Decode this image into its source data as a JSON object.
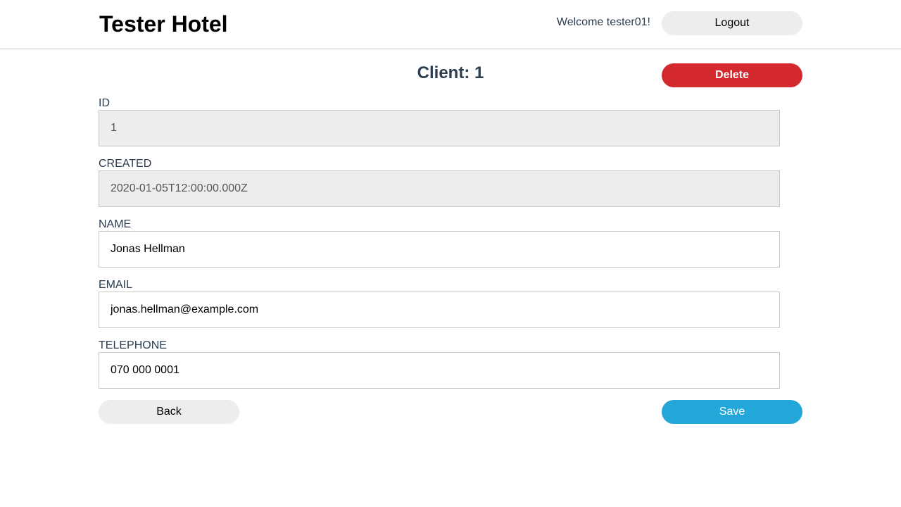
{
  "header": {
    "brand": "Tester Hotel",
    "welcome": "Welcome tester01!",
    "logout_label": "Logout"
  },
  "page": {
    "title": "Client: 1",
    "delete_label": "Delete"
  },
  "fields": [
    {
      "label": "ID",
      "value": "1",
      "disabled": true
    },
    {
      "label": "CREATED",
      "value": "2020-01-05T12:00:00.000Z",
      "disabled": true
    },
    {
      "label": "NAME",
      "value": "Jonas Hellman",
      "disabled": false
    },
    {
      "label": "EMAIL",
      "value": "jonas.hellman@example.com",
      "disabled": false
    },
    {
      "label": "TELEPHONE",
      "value": "070 000 0001",
      "disabled": false
    }
  ],
  "actions": {
    "back_label": "Back",
    "save_label": "Save"
  },
  "colors": {
    "delete": "#d3292f",
    "save": "#23a7d9",
    "neutral_button": "#ededed",
    "heading": "#2c3e50"
  }
}
